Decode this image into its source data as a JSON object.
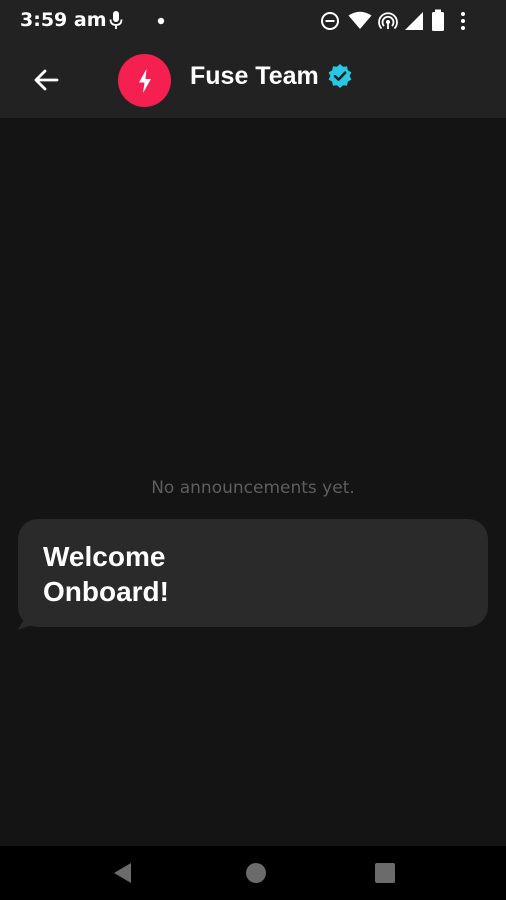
{
  "status_bar": {
    "time": "3:59 am",
    "icons": [
      "mic-icon",
      "notification-dot-icon",
      "do-not-disturb-icon",
      "wifi-icon",
      "hotspot-icon",
      "signal-icon",
      "battery-icon",
      "more-icon"
    ]
  },
  "app_bar": {
    "title": "Fuse Team",
    "back_icon": "arrow-left-icon",
    "avatar_icon": "lightning-icon",
    "verified_icon": "verified-badge-icon"
  },
  "content": {
    "empty_text": "No announcements yet.",
    "message": "Welcome\nOnboard!"
  },
  "nav_bar": {
    "icons": [
      "nav-back-icon",
      "nav-home-icon",
      "nav-recents-icon"
    ]
  },
  "colors": {
    "background": "#141414",
    "bars": "#222222",
    "avatar": "#f5204f",
    "verified": "#29c7e6",
    "bubble": "#2a2a2a",
    "muted_text": "#5e5e5e"
  }
}
